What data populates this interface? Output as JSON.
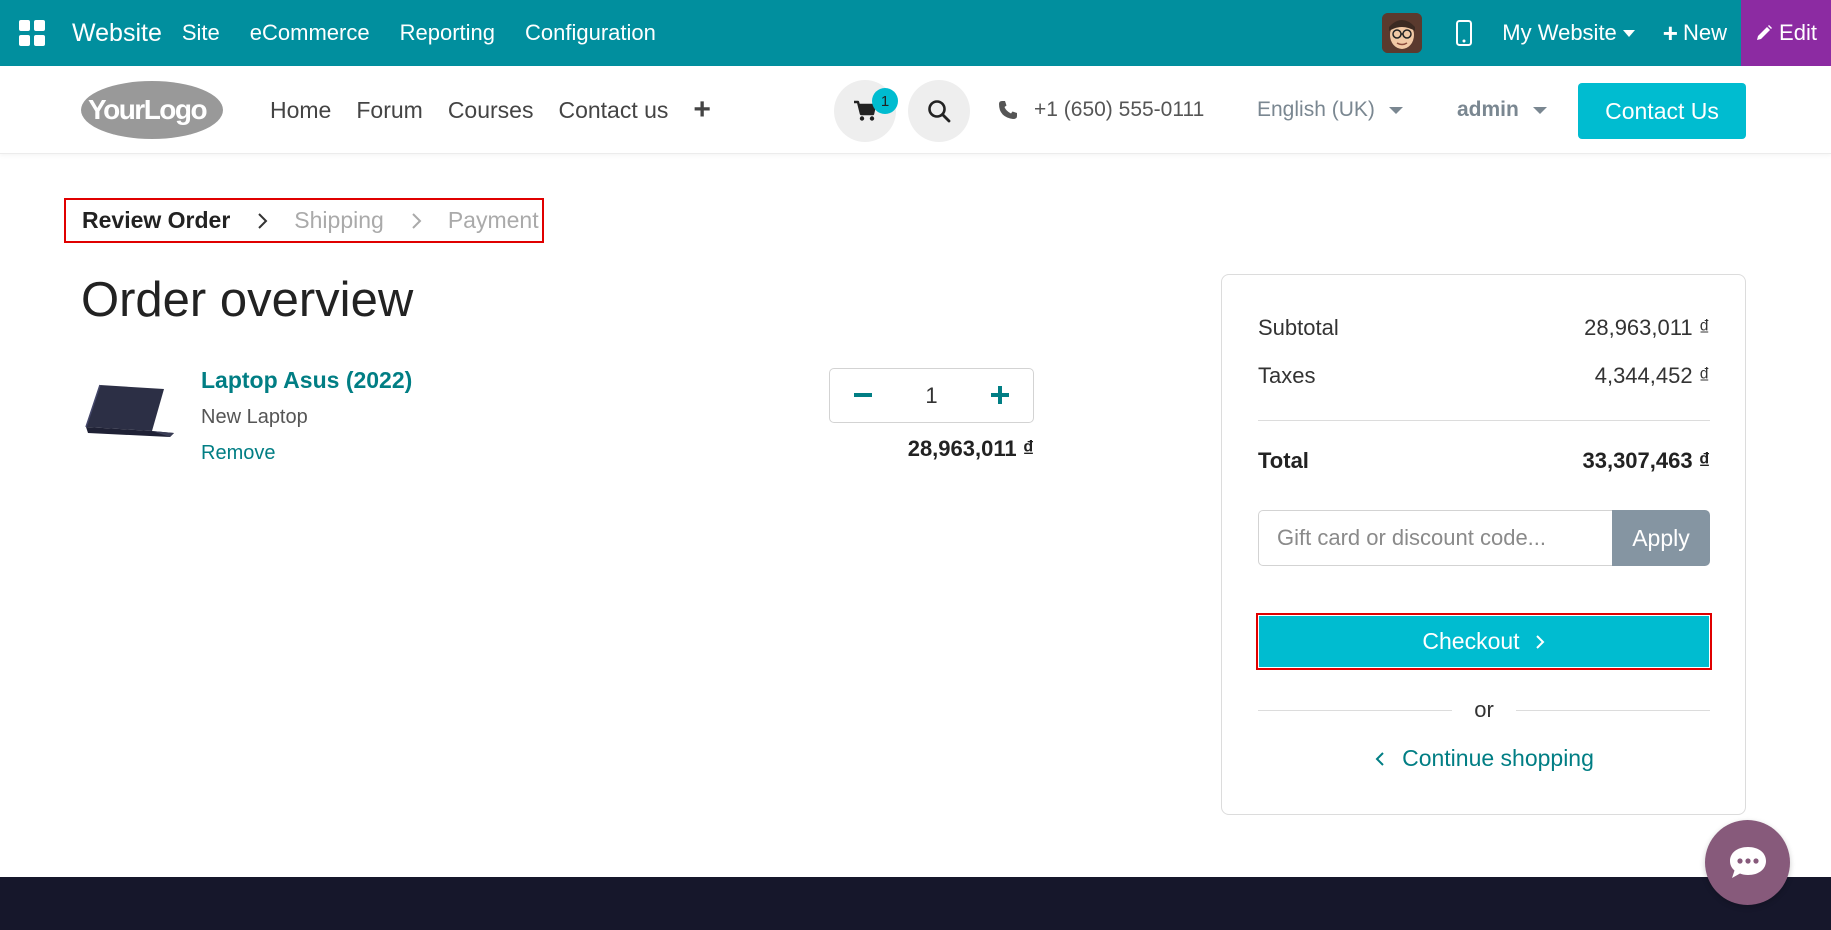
{
  "adminbar": {
    "brand": "Website",
    "menu": [
      "Site",
      "eCommerce",
      "Reporting",
      "Configuration"
    ],
    "website_selector": "My Website",
    "new_label": "New",
    "edit_label": "Edit"
  },
  "header": {
    "logo_text": "YourLogo",
    "nav": [
      "Home",
      "Forum",
      "Courses",
      "Contact us"
    ],
    "cart_count": "1",
    "phone": "+1 (650) 555-0111",
    "language": "English (UK)",
    "user": "admin",
    "contact_button": "Contact Us"
  },
  "progress": {
    "steps": [
      "Review Order",
      "Shipping",
      "Payment"
    ],
    "active_index": 0
  },
  "order": {
    "title": "Order overview",
    "items": [
      {
        "name": "Laptop Asus (2022)",
        "description": "New Laptop",
        "remove_label": "Remove",
        "quantity": "1",
        "price": "28,963,011 ₫"
      }
    ]
  },
  "summary": {
    "subtotal_label": "Subtotal",
    "subtotal_value": "28,963,011 ₫",
    "taxes_label": "Taxes",
    "taxes_value": "4,344,452 ₫",
    "total_label": "Total",
    "total_value": "33,307,463 ₫",
    "promo_placeholder": "Gift card or discount code...",
    "apply_label": "Apply",
    "checkout_label": "Checkout",
    "or_label": "or",
    "continue_label": "Continue shopping"
  },
  "colors": {
    "admin_bar": "#018f9e",
    "edit_button": "#8c2ba2",
    "primary": "#00bcd0",
    "link": "#017e84",
    "footer": "#16172b",
    "chat": "#875a7b"
  }
}
